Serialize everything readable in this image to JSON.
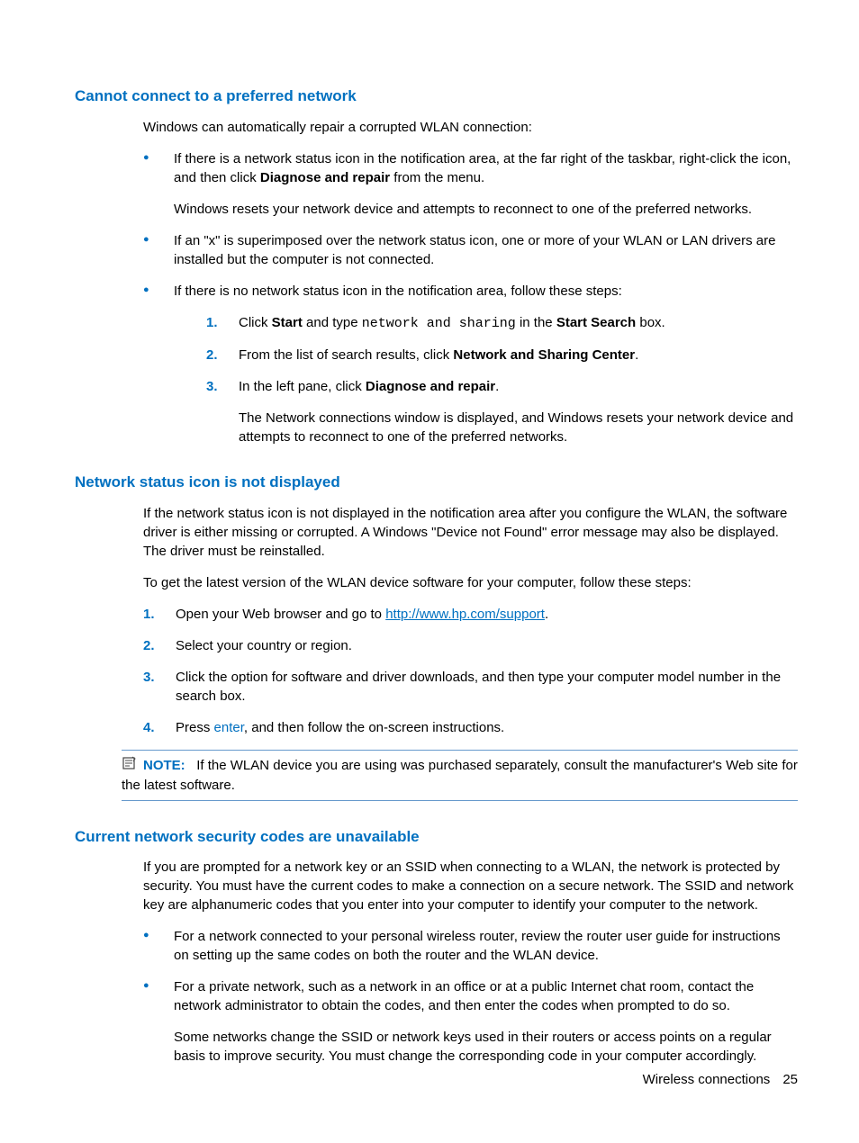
{
  "section1": {
    "heading": "Cannot connect to a preferred network",
    "intro": "Windows can automatically repair a corrupted WLAN connection:",
    "bullets": [
      {
        "text_pre": "If there is a network status icon in the notification area, at the far right of the taskbar, right-click the icon, and then click ",
        "bold1": "Diagnose and repair",
        "text_post": " from the menu.",
        "sub": "Windows resets your network device and attempts to reconnect to one of the preferred networks."
      },
      {
        "text": "If an \"x\" is superimposed over the network status icon, one or more of your WLAN or LAN drivers are installed but the computer is not connected."
      },
      {
        "text": "If there is no network status icon in the notification area, follow these steps:",
        "steps": [
          {
            "pre": "Click ",
            "b1": "Start",
            "mid1": " and type ",
            "mono": "network and sharing",
            "mid2": " in the ",
            "b2": "Start Search",
            "post": " box."
          },
          {
            "pre": "From the list of search results, click ",
            "b1": "Network and Sharing Center",
            "post": "."
          },
          {
            "pre": "In the left pane, click ",
            "b1": "Diagnose and repair",
            "post": ".",
            "sub": "The Network connections window is displayed, and Windows resets your network device and attempts to reconnect to one of the preferred networks."
          }
        ]
      }
    ]
  },
  "section2": {
    "heading": "Network status icon is not displayed",
    "para1": "If the network status icon is not displayed in the notification area after you configure the WLAN, the software driver is either missing or corrupted. A Windows \"Device not Found\" error message may also be displayed. The driver must be reinstalled.",
    "para2": "To get the latest version of the WLAN device software for your computer, follow these steps:",
    "steps": [
      {
        "pre": "Open your Web browser and go to ",
        "link": "http://www.hp.com/support",
        "post": "."
      },
      {
        "text": "Select your country or region."
      },
      {
        "text": "Click the option for software and driver downloads, and then type your computer model number in the search box."
      },
      {
        "pre": "Press ",
        "key": "enter",
        "post": ", and then follow the on-screen instructions."
      }
    ],
    "note": {
      "label": "NOTE:",
      "text": "If the WLAN device you are using was purchased separately, consult the manufacturer's Web site for the latest software."
    }
  },
  "section3": {
    "heading": "Current network security codes are unavailable",
    "para1": "If you are prompted for a network key or an SSID when connecting to a WLAN, the network is protected by security. You must have the current codes to make a connection on a secure network. The SSID and network key are alphanumeric codes that you enter into your computer to identify your computer to the network.",
    "bullets": [
      {
        "text": "For a network connected to your personal wireless router, review the router user guide for instructions on setting up the same codes on both the router and the WLAN device."
      },
      {
        "text": "For a private network, such as a network in an office or at a public Internet chat room, contact the network administrator to obtain the codes, and then enter the codes when prompted to do so.",
        "sub": "Some networks change the SSID or network keys used in their routers or access points on a regular basis to improve security. You must change the corresponding code in your computer accordingly."
      }
    ]
  },
  "footer": {
    "section": "Wireless connections",
    "page": "25"
  }
}
